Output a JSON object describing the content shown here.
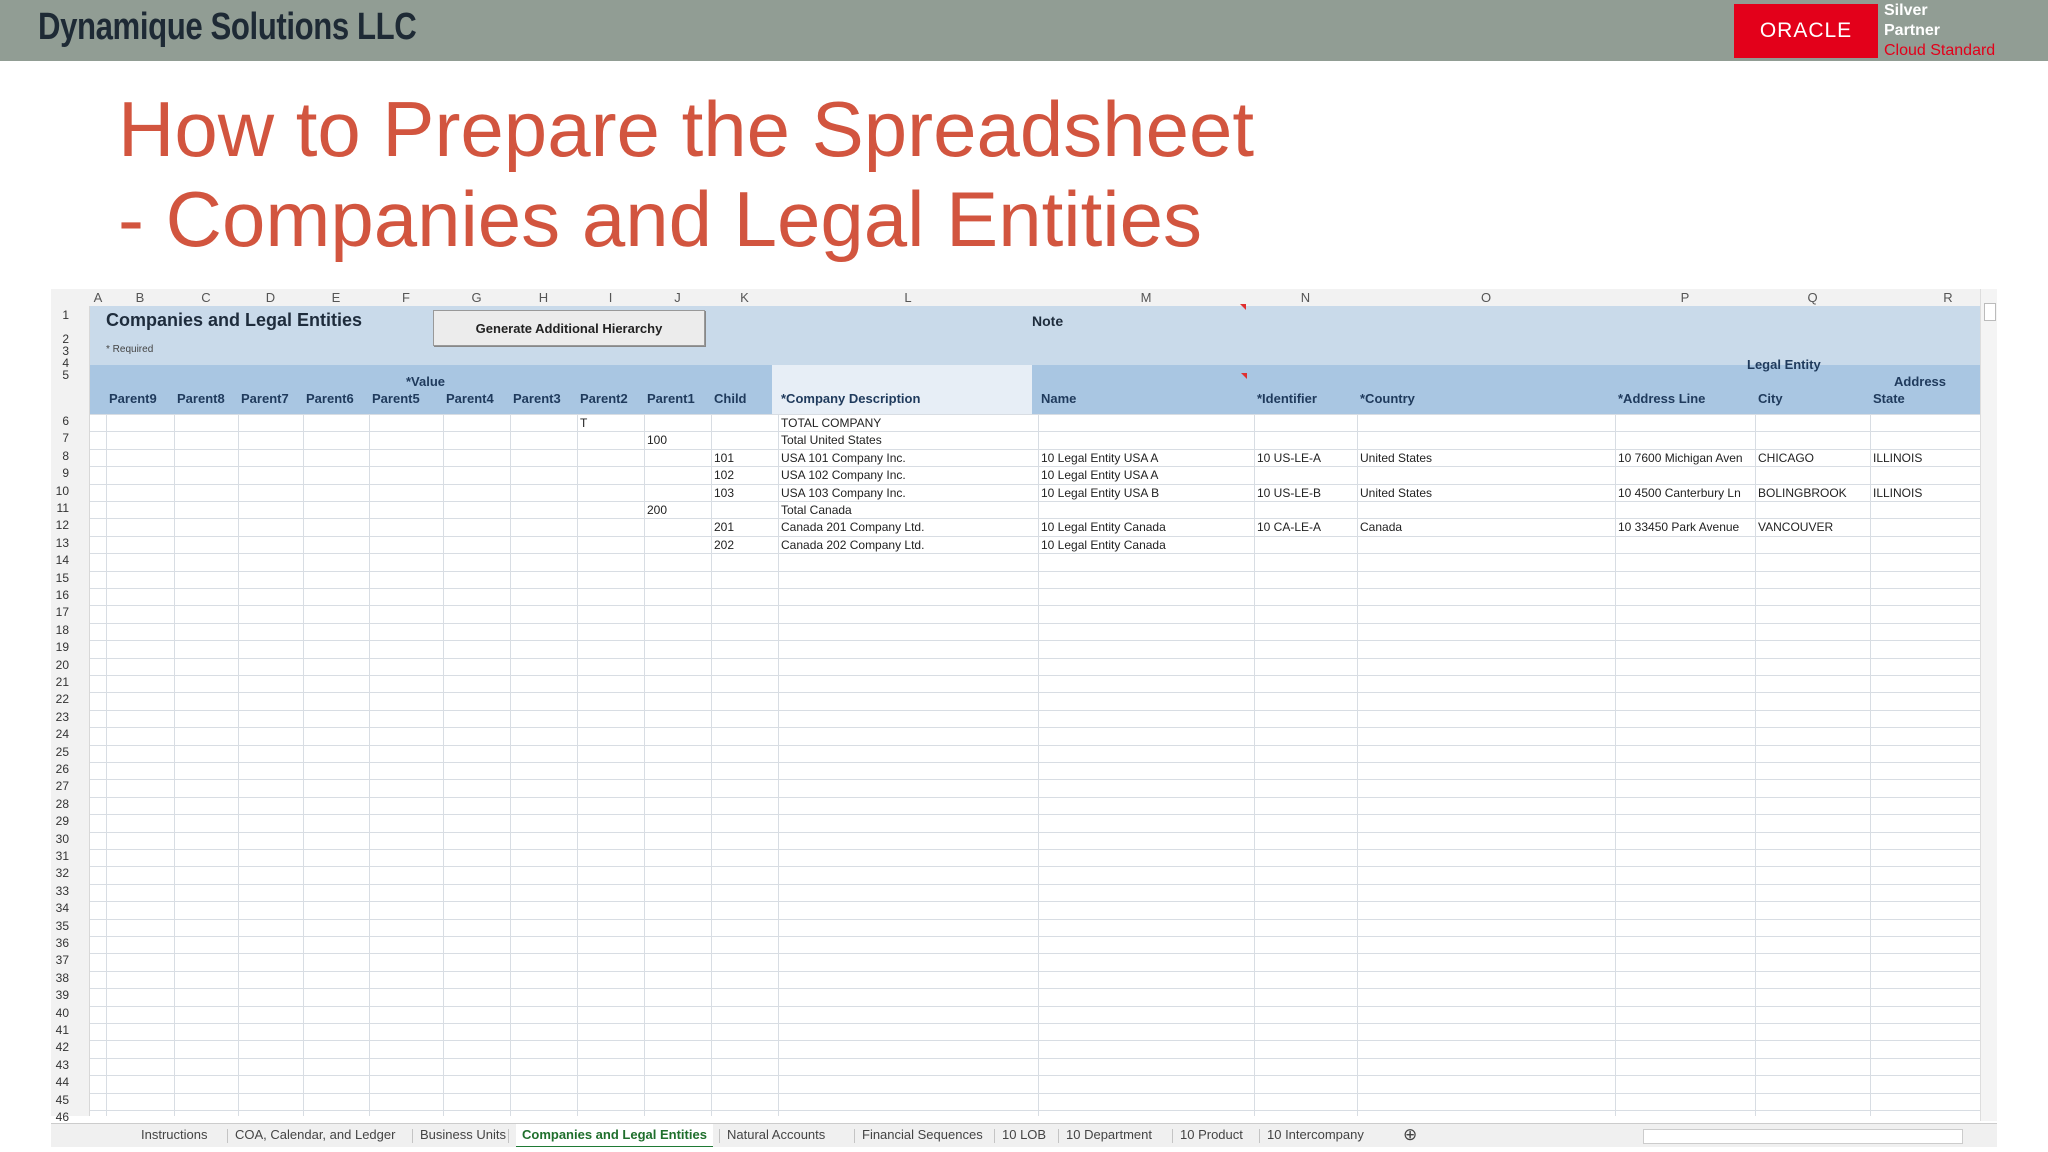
{
  "banner": {
    "company": "Dynamique Solutions LLC",
    "oracle": "ORACLE",
    "partner_line1": "Silver",
    "partner_line2": "Partner",
    "partner_line3": "Cloud Standard",
    "colors": {
      "banner_bg": "#919d94",
      "oracle_red": "#e3001a",
      "title_orange": "#d2553f"
    }
  },
  "slide": {
    "title_line1": "How to Prepare the Spreadsheet",
    "title_line2": "- Companies and Legal Entities"
  },
  "sheet": {
    "columns": [
      "A",
      "B",
      "C",
      "D",
      "E",
      "F",
      "G",
      "H",
      "I",
      "J",
      "K",
      "L",
      "M",
      "N",
      "O",
      "P",
      "Q",
      "R"
    ],
    "title": "Companies and Legal Entities",
    "required": "* Required",
    "generate_button": "Generate Additional Hierarchy",
    "note": "Note",
    "value_label": "*Value",
    "legal_entity_label": "Legal Entity",
    "address_label": "Address",
    "headers": [
      "Parent9",
      "Parent8",
      "Parent7",
      "Parent6",
      "Parent5",
      "Parent4",
      "Parent3",
      "Parent2",
      "Parent1",
      "Child",
      "*Company Description",
      "Name",
      "*Identifier",
      "*Country",
      "*Address Line",
      "City",
      "State"
    ],
    "rows": [
      {
        "parent2": "T",
        "parent1": "",
        "child": "",
        "desc": "TOTAL COMPANY",
        "name": "",
        "ident": "",
        "country": "",
        "addr": "",
        "city": "",
        "state": ""
      },
      {
        "parent2": "",
        "parent1": "100",
        "child": "",
        "desc": "Total United States",
        "name": "",
        "ident": "",
        "country": "",
        "addr": "",
        "city": "",
        "state": ""
      },
      {
        "parent2": "",
        "parent1": "",
        "child": "101",
        "desc": "USA 101 Company Inc.",
        "name": "10 Legal Entity USA A",
        "ident": "10 US-LE-A",
        "country": "United States",
        "addr": "10 7600 Michigan Aven",
        "city": "CHICAGO",
        "state": "ILLINOIS"
      },
      {
        "parent2": "",
        "parent1": "",
        "child": "102",
        "desc": "USA 102 Company Inc.",
        "name": "10 Legal Entity USA A",
        "ident": "",
        "country": "",
        "addr": "",
        "city": "",
        "state": ""
      },
      {
        "parent2": "",
        "parent1": "",
        "child": "103",
        "desc": "USA 103 Company Inc.",
        "name": "10 Legal Entity USA B",
        "ident": "10 US-LE-B",
        "country": "United States",
        "addr": "10 4500 Canterbury Ln",
        "city": "BOLINGBROOK",
        "state": "ILLINOIS"
      },
      {
        "parent2": "",
        "parent1": "200",
        "child": "",
        "desc": "Total Canada",
        "name": "",
        "ident": "",
        "country": "",
        "addr": "",
        "city": "",
        "state": ""
      },
      {
        "parent2": "",
        "parent1": "",
        "child": "201",
        "desc": "Canada 201 Company Ltd.",
        "name": "10 Legal Entity Canada",
        "ident": "10 CA-LE-A",
        "country": "Canada",
        "addr": "10 33450 Park Avenue",
        "city": "VANCOUVER",
        "state": ""
      },
      {
        "parent2": "",
        "parent1": "",
        "child": "202",
        "desc": "Canada 202 Company Ltd.",
        "name": "10 Legal Entity Canada",
        "ident": "",
        "country": "",
        "addr": "",
        "city": "",
        "state": ""
      }
    ],
    "tabs": [
      "Instructions",
      "COA, Calendar, and Ledger",
      "Business Units",
      "Companies and Legal Entities",
      "Natural Accounts",
      "Financial Sequences",
      "10 LOB",
      "10 Department",
      "10 Product",
      "10 Intercompany"
    ],
    "active_tab": "Companies and Legal Entities",
    "add_sheet_icon": "plus-circle-icon"
  }
}
